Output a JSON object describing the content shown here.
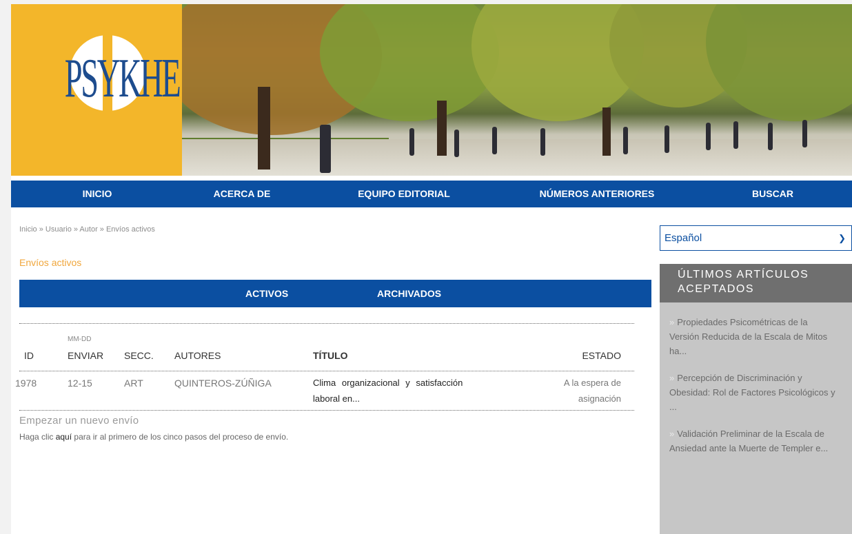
{
  "brand": {
    "logo_text": "PSYKHE"
  },
  "colors": {
    "nav_blue": "#0b4fa1",
    "logo_yellow": "#f3b62a",
    "heading_orange": "#f0a63b",
    "sidebar_gray": "#c6c6c6"
  },
  "nav": {
    "items": [
      {
        "label": "INICIO"
      },
      {
        "label": "ACERCA DE"
      },
      {
        "label": "EQUIPO EDITORIAL"
      },
      {
        "label": "NÚMEROS ANTERIORES"
      },
      {
        "label": "BUSCAR"
      }
    ]
  },
  "breadcrumb": {
    "text": "Inicio » Usuario » Autor » Envíos activos"
  },
  "main": {
    "heading": "Envíos activos",
    "tabs": [
      {
        "label": "ACTIVOS"
      },
      {
        "label": "ARCHIVADOS"
      }
    ],
    "table": {
      "date_format": "MM-DD",
      "headers": {
        "id": "ID",
        "enviar": "ENVIAR",
        "secc": "SECC.",
        "autores": "AUTORES",
        "titulo": "TÍTULO",
        "estado": "ESTADO"
      },
      "rows": [
        {
          "id": "1978",
          "enviar": "12-15",
          "secc": "ART",
          "autores": "QUINTEROS-ZÚÑIGA",
          "titulo_l1": "Clima organizacional y satisfacción",
          "titulo_l2": "laboral en...",
          "estado_l1": "A la espera de",
          "estado_l2": "asignación"
        }
      ]
    },
    "new_submission": {
      "title": "Empezar un nuevo envío",
      "prefix": "Haga clic",
      "link": "aquí",
      "suffix": "para ir al primero de los cinco pasos del proceso de envío."
    }
  },
  "sidebar": {
    "language": {
      "selected": "Español"
    },
    "latest_title_l1": "ÚLTIMOS ARTÍCULOS",
    "latest_title_l2": "ACEPTADOS",
    "articles": [
      {
        "title": "Propiedades Psicométricas de la Versión Reducida de la Escala de Mitos ha..."
      },
      {
        "title": "Percepción de Discriminación y Obesidad: Rol de Factores Psicológicos y ..."
      },
      {
        "title": "Validación Preliminar de la Escala de Ansiedad ante la Muerte de Templer e..."
      }
    ]
  }
}
